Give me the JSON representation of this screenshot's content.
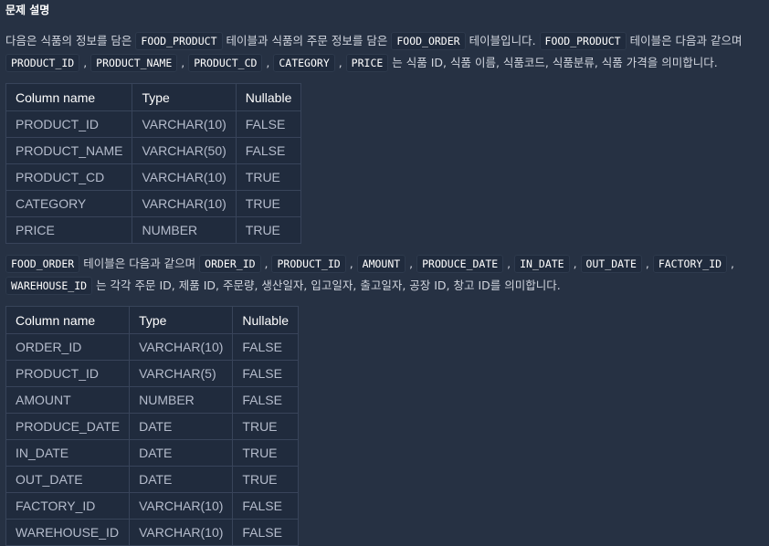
{
  "section_title": "문제 설명",
  "intro": {
    "line1": {
      "t1": "다음은 식품의 정보를 담은 ",
      "c1": "FOOD_PRODUCT",
      "t2": " 테이블과 식품의 주문 정보를 담은 ",
      "c2": "FOOD_ORDER",
      "t3": " 테이블입니다. ",
      "c3": "FOOD_PRODUCT",
      "t4": " 테이블은 다음과 같으며"
    },
    "line2": {
      "c1": "PRODUCT_ID",
      "s1": " , ",
      "c2": "PRODUCT_NAME",
      "s2": " , ",
      "c3": "PRODUCT_CD",
      "s3": " , ",
      "c4": "CATEGORY",
      "s4": " , ",
      "c5": "PRICE",
      "t1": " 는 식품 ID, 식품 이름, 식품코드, 식품분류, 식품 가격을 의미합니다."
    }
  },
  "table1": {
    "headers": [
      "Column name",
      "Type",
      "Nullable"
    ],
    "rows": [
      [
        "PRODUCT_ID",
        "VARCHAR(10)",
        "FALSE"
      ],
      [
        "PRODUCT_NAME",
        "VARCHAR(50)",
        "FALSE"
      ],
      [
        "PRODUCT_CD",
        "VARCHAR(10)",
        "TRUE"
      ],
      [
        "CATEGORY",
        "VARCHAR(10)",
        "TRUE"
      ],
      [
        "PRICE",
        "NUMBER",
        "TRUE"
      ]
    ]
  },
  "order_desc": {
    "line1": {
      "c1": "FOOD_ORDER",
      "t1": " 테이블은 다음과 같으며 ",
      "c2": "ORDER_ID",
      "s1": " , ",
      "c3": "PRODUCT_ID",
      "s2": " , ",
      "c4": "AMOUNT",
      "s3": " , ",
      "c5": "PRODUCE_DATE",
      "s4": " , ",
      "c6": "IN_DATE",
      "s5": " , ",
      "c7": "OUT_DATE",
      "s6": " , ",
      "c8": "FACTORY_ID",
      "s7": " ,"
    },
    "line2": {
      "c1": "WAREHOUSE_ID",
      "t1": " 는 각각 주문 ID, 제품 ID, 주문량, 생산일자, 입고일자, 출고일자, 공장 ID, 창고 ID를 의미합니다."
    }
  },
  "table2": {
    "headers": [
      "Column name",
      "Type",
      "Nullable"
    ],
    "rows": [
      [
        "ORDER_ID",
        "VARCHAR(10)",
        "FALSE"
      ],
      [
        "PRODUCT_ID",
        "VARCHAR(5)",
        "FALSE"
      ],
      [
        "AMOUNT",
        "NUMBER",
        "FALSE"
      ],
      [
        "PRODUCE_DATE",
        "DATE",
        "TRUE"
      ],
      [
        "IN_DATE",
        "DATE",
        "TRUE"
      ],
      [
        "OUT_DATE",
        "DATE",
        "TRUE"
      ],
      [
        "FACTORY_ID",
        "VARCHAR(10)",
        "FALSE"
      ],
      [
        "WAREHOUSE_ID",
        "VARCHAR(10)",
        "FALSE"
      ]
    ]
  }
}
